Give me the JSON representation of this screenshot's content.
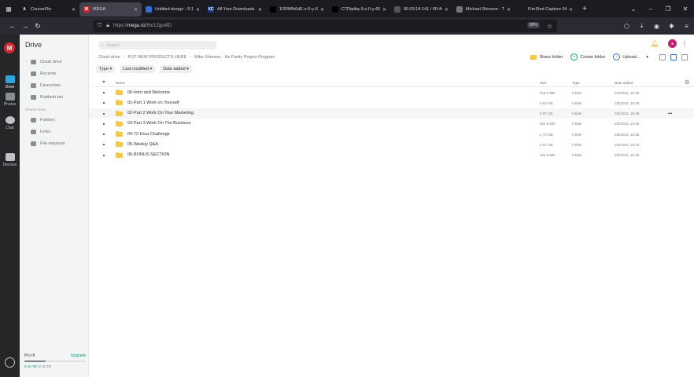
{
  "browser": {
    "tabs": [
      {
        "title": "CourseFlix",
        "fav_color": "#1a1a1a",
        "fav_letter": "A",
        "active": false
      },
      {
        "title": "MEGA",
        "fav_color": "#d9272e",
        "fav_letter": "M",
        "active": true
      },
      {
        "title": "Untitled design - 9:1",
        "fav_color": "#2e6fd8",
        "fav_letter": "",
        "active": false
      },
      {
        "title": "All Your Downloads",
        "fav_color": "#1b3a8a",
        "fav_letter": "XC",
        "active": false
      },
      {
        "title": "1f30Wlh6dE-z-0-y-6679",
        "fav_color": "#000000",
        "fav_letter": "",
        "active": false
      },
      {
        "title": "C7Dtpikq-3-z-0-y-6679",
        "fav_color": "#000000",
        "fav_letter": "",
        "active": false
      },
      {
        "title": "00:03:14.141 / 00:44",
        "fav_color": "#555555",
        "fav_letter": "",
        "active": false
      },
      {
        "title": "Michael Shreeve - Tr",
        "fav_color": "#777777",
        "fav_letter": "",
        "active": false
      },
      {
        "title": "FireShot Capture 047 - Lo",
        "fav_color": "#1c1b22",
        "fav_letter": "",
        "active": false
      }
    ],
    "url_scheme": "https://",
    "url_host": "mega.nz",
    "url_path": "/fm/1Zgu4fD",
    "zoom": "80%"
  },
  "rail": {
    "logo": "M",
    "items": [
      {
        "label": "Drive",
        "icon": "drive-icon",
        "active": true
      },
      {
        "label": "Photos",
        "icon": "photos-icon",
        "active": false
      },
      {
        "label": "Chat",
        "icon": "chat-icon",
        "active": false
      },
      {
        "label": "Devices",
        "icon": "devices-icon",
        "active": false
      }
    ]
  },
  "sidebar": {
    "title": "Drive",
    "items": [
      {
        "label": "Cloud drive",
        "icon": "cloud-icon"
      },
      {
        "label": "Recents",
        "icon": "clock-icon"
      },
      {
        "label": "Favourites",
        "icon": "heart-icon"
      },
      {
        "label": "Rubbish bin",
        "icon": "trash-icon"
      }
    ],
    "section": "Shared items",
    "shared": [
      {
        "label": "Folders",
        "icon": "shared-folder-icon"
      },
      {
        "label": "Links",
        "icon": "link-icon"
      },
      {
        "label": "File requests",
        "icon": "file-request-icon"
      }
    ],
    "storage": {
      "plan": "Pro III",
      "upgrade": "Upgrade",
      "used": "5.46 TB",
      "total": "of 16 TB",
      "fraction": 0.34
    }
  },
  "main": {
    "search_placeholder": "Search",
    "breadcrumbs": [
      "Cloud drive",
      "PUT NEW PRODUCTS HERE",
      "Mike Shreeve - No Pants Project Program"
    ],
    "actions": {
      "share": "Share folder",
      "create": "Create folder",
      "upload": "Upload..."
    },
    "filters": [
      "Type",
      "Last modified",
      "Date added"
    ],
    "columns": {
      "name": "Name",
      "size": "Size",
      "type": "Type",
      "date": "Date added"
    },
    "rows": [
      {
        "name": "00-Intro and Welcome",
        "size": "518.0 MB",
        "type": "Folder",
        "date": "2/5/2022, 16:28"
      },
      {
        "name": "01-Part 1 Work on Yourself",
        "size": "9.63 GB",
        "type": "Folder",
        "date": "2/5/2022, 16:28"
      },
      {
        "name": "02-Part 2 Work On Your Marketing",
        "size": "8.97 GB",
        "type": "Folder",
        "date": "2/5/2022, 16:28"
      },
      {
        "name": "03-Part 3 Work On The Business",
        "size": "651.8 MB",
        "type": "Folder",
        "date": "2/5/2022, 16:28"
      },
      {
        "name": "04-72 Hour Challenge",
        "size": "1.74 GB",
        "type": "Folder",
        "date": "2/5/2022, 16:38"
      },
      {
        "name": "05-Weekly Q&A",
        "size": "8.87 GB",
        "type": "Folder",
        "date": "2/5/2022, 16:34"
      },
      {
        "name": "06-BONUS SECTION",
        "size": "462.8 MB",
        "type": "Folder",
        "date": "2/5/2022, 16:28"
      }
    ]
  },
  "colors": {
    "folder": "#f8c93a",
    "accent": "#d9272e",
    "green": "#00a382",
    "blue": "#2e6fd8"
  }
}
